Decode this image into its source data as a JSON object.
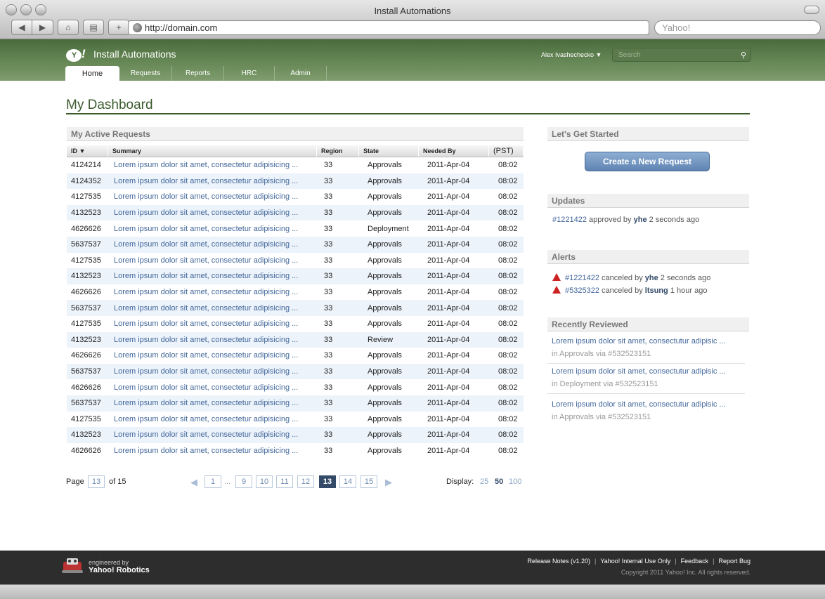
{
  "browser": {
    "window_title": "Install Automations",
    "url": "http://domain.com",
    "search_placeholder": "Yahoo!"
  },
  "app": {
    "logo": "Y!",
    "title": "Install Automations",
    "user": "Alex Ivashechecko ▼",
    "search_placeholder": "Search",
    "tabs": [
      {
        "label": "Home",
        "active": true
      },
      {
        "label": "Requests"
      },
      {
        "label": "Reports"
      },
      {
        "label": "HRC"
      },
      {
        "label": "Admin"
      }
    ]
  },
  "page_title": "My Dashboard",
  "active_requests": {
    "heading": "My Active Requests",
    "columns": [
      "ID ▼",
      "Summary",
      "Region",
      "State",
      "Needed By",
      "(PST)"
    ],
    "rows": [
      {
        "id": "4124214",
        "summary": "Lorem ipsum dolor sit amet, consectetur adipisicing  ...",
        "region": "33",
        "state": "Approvals",
        "needed_by": "2011-Apr-04",
        "time": "08:02"
      },
      {
        "id": "4124352",
        "summary": "Lorem ipsum dolor sit amet, consectetur adipisicing  ...",
        "region": "33",
        "state": "Approvals",
        "needed_by": "2011-Apr-04",
        "time": "08:02"
      },
      {
        "id": "4127535",
        "summary": "Lorem ipsum dolor sit amet, consectetur adipisicing  ...",
        "region": "33",
        "state": "Approvals",
        "needed_by": "2011-Apr-04",
        "time": "08:02"
      },
      {
        "id": "4132523",
        "summary": "Lorem ipsum dolor sit amet, consectetur adipisicing  ...",
        "region": "33",
        "state": "Approvals",
        "needed_by": "2011-Apr-04",
        "time": "08:02"
      },
      {
        "id": "4626626",
        "summary": "Lorem ipsum dolor sit amet, consectetur adipisicing  ...",
        "region": "33",
        "state": "Deployment",
        "needed_by": "2011-Apr-04",
        "time": "08:02"
      },
      {
        "id": "5637537",
        "summary": "Lorem ipsum dolor sit amet, consectetur adipisicing  ...",
        "region": "33",
        "state": "Approvals",
        "needed_by": "2011-Apr-04",
        "time": "08:02"
      },
      {
        "id": "4127535",
        "summary": "Lorem ipsum dolor sit amet, consectetur adipisicing  ...",
        "region": "33",
        "state": "Approvals",
        "needed_by": "2011-Apr-04",
        "time": "08:02"
      },
      {
        "id": "4132523",
        "summary": "Lorem ipsum dolor sit amet, consectetur adipisicing  ...",
        "region": "33",
        "state": "Approvals",
        "needed_by": "2011-Apr-04",
        "time": "08:02"
      },
      {
        "id": "4626626",
        "summary": "Lorem ipsum dolor sit amet, consectetur adipisicing  ...",
        "region": "33",
        "state": "Approvals",
        "needed_by": "2011-Apr-04",
        "time": "08:02"
      },
      {
        "id": "5637537",
        "summary": "Lorem ipsum dolor sit amet, consectetur adipisicing  ...",
        "region": "33",
        "state": "Approvals",
        "needed_by": "2011-Apr-04",
        "time": "08:02"
      },
      {
        "id": "4127535",
        "summary": "Lorem ipsum dolor sit amet, consectetur adipisicing  ...",
        "region": "33",
        "state": "Approvals",
        "needed_by": "2011-Apr-04",
        "time": "08:02"
      },
      {
        "id": "4132523",
        "summary": "Lorem ipsum dolor sit amet, consectetur adipisicing  ...",
        "region": "33",
        "state": "Review",
        "needed_by": "2011-Apr-04",
        "time": "08:02"
      },
      {
        "id": "4626626",
        "summary": "Lorem ipsum dolor sit amet, consectetur adipisicing  ...",
        "region": "33",
        "state": "Approvals",
        "needed_by": "2011-Apr-04",
        "time": "08:02"
      },
      {
        "id": "5637537",
        "summary": "Lorem ipsum dolor sit amet, consectetur adipisicing  ...",
        "region": "33",
        "state": "Approvals",
        "needed_by": "2011-Apr-04",
        "time": "08:02"
      },
      {
        "id": "4626626",
        "summary": "Lorem ipsum dolor sit amet, consectetur adipisicing  ...",
        "region": "33",
        "state": "Approvals",
        "needed_by": "2011-Apr-04",
        "time": "08:02"
      },
      {
        "id": "5637537",
        "summary": "Lorem ipsum dolor sit amet, consectetur adipisicing  ...",
        "region": "33",
        "state": "Approvals",
        "needed_by": "2011-Apr-04",
        "time": "08:02"
      },
      {
        "id": "4127535",
        "summary": "Lorem ipsum dolor sit amet, consectetur adipisicing  ...",
        "region": "33",
        "state": "Approvals",
        "needed_by": "2011-Apr-04",
        "time": "08:02"
      },
      {
        "id": "4132523",
        "summary": "Lorem ipsum dolor sit amet, consectetur adipisicing  ...",
        "region": "33",
        "state": "Approvals",
        "needed_by": "2011-Apr-04",
        "time": "08:02"
      },
      {
        "id": "4626626",
        "summary": "Lorem ipsum dolor sit amet, consectetur adipisicing  ...",
        "region": "33",
        "state": "Approvals",
        "needed_by": "2011-Apr-04",
        "time": "08:02"
      }
    ]
  },
  "pager": {
    "page_label": "Page",
    "current_page": "13",
    "of_label": "of 15",
    "pages": [
      "1",
      "...",
      "9",
      "10",
      "11",
      "12",
      "13",
      "14",
      "15"
    ],
    "display_label": "Display:",
    "display_options": [
      "25",
      "50",
      "100"
    ],
    "display_selected": "50"
  },
  "get_started": {
    "heading": "Let's Get Started",
    "button": "Create a New Request"
  },
  "updates": {
    "heading": "Updates",
    "items": [
      {
        "link": "#1221422",
        "text": " approved by ",
        "user": "yhe",
        "time": " 2 seconds ago"
      }
    ]
  },
  "alerts": {
    "heading": "Alerts",
    "items": [
      {
        "link": "#1221422",
        "text": " canceled by ",
        "user": "yhe",
        "time": " 2 seconds ago"
      },
      {
        "link": "#5325322",
        "text": " canceled by ",
        "user": "ltsung",
        "time": " 1 hour ago"
      }
    ]
  },
  "recently_reviewed": {
    "heading": "Recently Reviewed",
    "items": [
      {
        "title": "Lorem ipsum dolor sit amet, consectutur adipisic ...",
        "meta": "in Approvals  via #532523151"
      },
      {
        "title": "Lorem ipsum dolor sit amet, consectutur adipisic ...",
        "meta": "in Deployment  via #532523151"
      },
      {
        "title": "Lorem ipsum dolor sit amet, consectutur adipisic ...",
        "meta": "in Approvals  via #532523151"
      }
    ]
  },
  "footer": {
    "engineered_by": "engineered by",
    "team": "Yahoo! Robotics",
    "links": [
      "Release Notes (v1.20)",
      "Yahoo! Internal Use Only",
      "Feedback",
      "Report Bug"
    ],
    "copyright": "Copyright 2011 Yahoo! Inc. All rights reserved."
  },
  "colors": {
    "header_green": "#4a6b3c",
    "link_blue": "#42679a",
    "alert_red": "#cc2222"
  }
}
